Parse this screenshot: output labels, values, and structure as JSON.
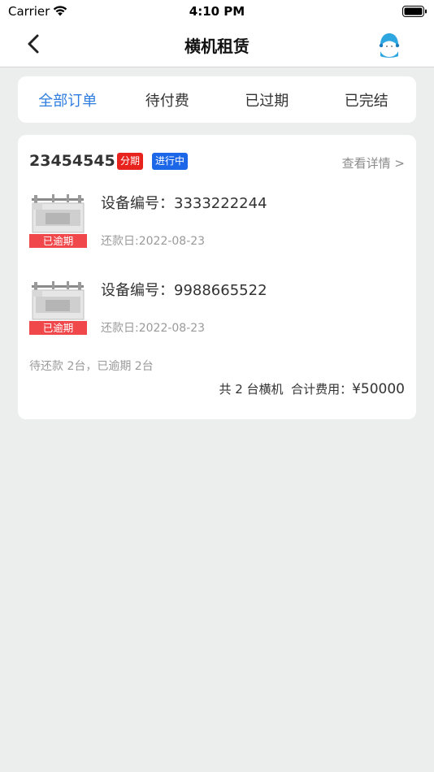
{
  "status_bar": {
    "carrier": "Carrier",
    "time": "4:10 PM"
  },
  "nav": {
    "title": "横机租赁",
    "back_icon": "chevron-left-icon",
    "service_icon": "customer-service-avatar-icon"
  },
  "tabs": [
    {
      "label": "全部订单",
      "active": true
    },
    {
      "label": "待付费",
      "active": false
    },
    {
      "label": "已过期",
      "active": false
    },
    {
      "label": "已完结",
      "active": false
    }
  ],
  "colors": {
    "accent": "#2f7ce0",
    "badge_installment": "#e8231d",
    "badge_progress": "#1c66e8",
    "overdue": "#f0474a"
  },
  "order": {
    "id": "23454545",
    "badge_installment": "分期",
    "badge_status": "进行中",
    "detail_link": "查看详情 >",
    "devices": [
      {
        "device_no": "设备编号：3333222244",
        "repay_date": "还款日:2022-08-23",
        "tag": "已逾期"
      },
      {
        "device_no": "设备编号：9988665522",
        "repay_date": "还款日:2022-08-23",
        "tag": "已逾期"
      }
    ],
    "summary_status": "待还款 2台，已逾期 2台",
    "total_count": "共 2 台横机",
    "total_label": "合计费用：",
    "total_amount": "¥50000"
  }
}
